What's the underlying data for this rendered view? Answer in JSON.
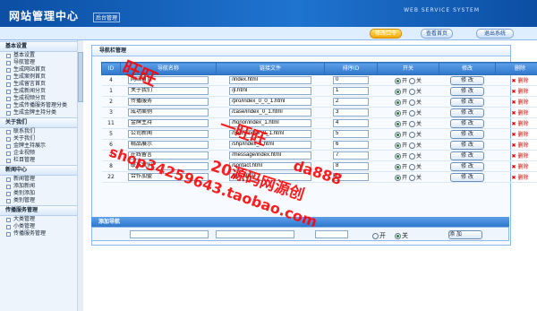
{
  "header": {
    "title": "网站管理中心",
    "subtitle": "后台管理",
    "service_text": "WEB SERVICE SYSTEM"
  },
  "nav": {
    "buttons": [
      "修改口令",
      "查看首页",
      "退出系统"
    ]
  },
  "sidebar": [
    {
      "title": "基本设置",
      "items": [
        "基本设置",
        "导航管理",
        "生成网站首页",
        "生成案例首页",
        "生成留言首页",
        "生成新闻分页",
        "生成视频分页",
        "生成传播服务管理分类",
        "生成金牌主持分类"
      ]
    },
    {
      "title": "关于我们",
      "items": [
        "联系我们",
        "关于我们",
        "金牌主持展示",
        "企业视频",
        "栏目管理"
      ]
    },
    {
      "title": "新闻中心",
      "items": [
        "新闻管理",
        "添加新闻",
        "类别添加",
        "类别管理"
      ]
    },
    {
      "title": "传播服务管理",
      "items": [
        "大类管理",
        "小类管理",
        "传播服务管理"
      ]
    }
  ],
  "panel": {
    "title": "导航栏管理"
  },
  "table": {
    "headers": [
      "ID",
      "导航名称",
      "链接文件",
      "排序ID",
      "开关",
      "修改",
      "删除"
    ],
    "rows": [
      {
        "id": "4",
        "name": "网站首页",
        "link": "/index.html",
        "order": "0",
        "on": "开",
        "off": "关",
        "edit": "修 改",
        "delete": "删除"
      },
      {
        "id": "1",
        "name": "关于我们",
        "link": "/jl.html",
        "order": "1",
        "on": "开",
        "off": "关",
        "edit": "修 改",
        "delete": "删除"
      },
      {
        "id": "2",
        "name": "传播服务",
        "link": "/pro/index_0_0_1.html",
        "order": "2",
        "on": "开",
        "off": "关",
        "edit": "修 改",
        "delete": "删除"
      },
      {
        "id": "3",
        "name": "成功案例",
        "link": "/case/index_0_1.html",
        "order": "3",
        "on": "开",
        "off": "关",
        "edit": "修 改",
        "delete": "删除"
      },
      {
        "id": "11",
        "name": "金牌主持",
        "link": "/honor/index_1.html",
        "order": "4",
        "on": "开",
        "off": "关",
        "edit": "修 改",
        "delete": "删除"
      },
      {
        "id": "5",
        "name": "公司新闻",
        "link": "/news/index_0_1.html",
        "order": "5",
        "on": "开",
        "off": "关",
        "edit": "修 改",
        "delete": "删除"
      },
      {
        "id": "6",
        "name": "精品展示",
        "link": "/shp/index_1.html",
        "order": "6",
        "on": "开",
        "off": "关",
        "edit": "修 改",
        "delete": "删除"
      },
      {
        "id": "7",
        "name": "在线留言",
        "link": "/message/index.html",
        "order": "7",
        "on": "开",
        "off": "关",
        "edit": "修 改",
        "delete": "删除"
      },
      {
        "id": "8",
        "name": "联系我们",
        "link": "/contact.html",
        "order": "8",
        "on": "开",
        "off": "关",
        "edit": "修 改",
        "delete": "删除"
      },
      {
        "id": "22",
        "name": "合作加盟",
        "link": "/join.html",
        "order": "10",
        "on": "开",
        "off": "关",
        "edit": "修 改",
        "delete": "删除"
      }
    ]
  },
  "add": {
    "title": "添加导航",
    "on": "开",
    "off": "关",
    "button": "添 加"
  },
  "watermarks": [
    "旺旺",
    "一旺旺",
    "20源码网源创",
    "shop34259643.taobao.com",
    "da888"
  ],
  "colors": {
    "accent": "#1f74cf",
    "active": "#f2a900",
    "watermark": "#ff0000"
  }
}
